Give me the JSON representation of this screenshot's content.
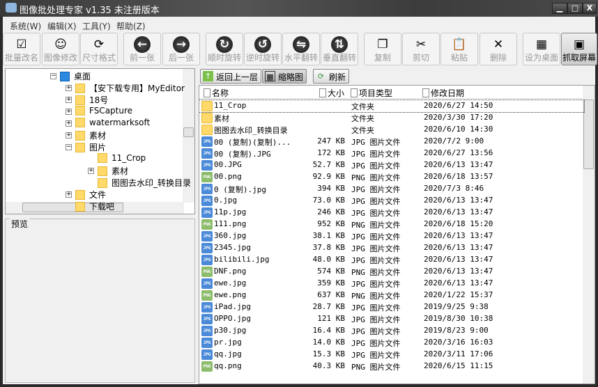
{
  "window": {
    "title": "图像批处理专家 v1.35 未注册版本",
    "min": "▁",
    "max": "□",
    "close": "X"
  },
  "menu": [
    "系统(W)",
    "编辑(X)",
    "工具(Y)",
    "帮助(Z)"
  ],
  "toolbar": [
    {
      "label": "批量改名",
      "icon": "rename-icon"
    },
    {
      "label": "图像修改",
      "icon": "portrait-icon"
    },
    {
      "label": "尺寸格式",
      "icon": "resize-icon"
    },
    {
      "label": "前一张",
      "icon": "arrow-left-icon"
    },
    {
      "label": "后一张",
      "icon": "arrow-right-icon"
    },
    {
      "label": "顺时旋转",
      "icon": "rotate-cw-icon"
    },
    {
      "label": "逆时旋转",
      "icon": "rotate-ccw-icon"
    },
    {
      "label": "水平翻转",
      "icon": "flip-horizontal-icon"
    },
    {
      "label": "垂直翻转",
      "icon": "flip-vertical-icon"
    },
    {
      "label": "复制",
      "icon": "copy-icon"
    },
    {
      "label": "剪切",
      "icon": "scissors-icon"
    },
    {
      "label": "粘贴",
      "icon": "paste-icon"
    },
    {
      "label": "删除",
      "icon": "delete-icon"
    },
    {
      "label": "设为桌面",
      "icon": "wallpaper-icon"
    },
    {
      "label": "抓取屏幕",
      "icon": "screenshot-icon"
    }
  ],
  "tree": [
    {
      "label": "桌面",
      "level": 0,
      "expander": "−"
    },
    {
      "label": "【安下载专用】MyEditor",
      "level": 1,
      "expander": "+"
    },
    {
      "label": "18号",
      "level": 1,
      "expander": "+"
    },
    {
      "label": "FSCapture",
      "level": 1,
      "expander": "+"
    },
    {
      "label": "watermarksoft",
      "level": 1,
      "expander": "+"
    },
    {
      "label": "素材",
      "level": 1,
      "expander": "+"
    },
    {
      "label": "图片",
      "level": 1,
      "expander": "−"
    },
    {
      "label": "11_Crop",
      "level": 2,
      "expander": ""
    },
    {
      "label": "素材",
      "level": 2,
      "expander": "+"
    },
    {
      "label": "图图去水印_转换目录",
      "level": 2,
      "expander": ""
    },
    {
      "label": "文件",
      "level": 1,
      "expander": "+"
    },
    {
      "label": "下载吧",
      "level": 1,
      "expander": ""
    }
  ],
  "preview_label": "预览",
  "nav": {
    "up": "返回上一层",
    "thumbs": "缩略图",
    "refresh": "刷新"
  },
  "columns": {
    "name": "名称",
    "size": "大小",
    "type": "项目类型",
    "date": "修改日期"
  },
  "files": [
    {
      "name": "11_Crop",
      "size": "",
      "type": "文件夹",
      "date": "2020/6/27 14:50",
      "kind": "folder"
    },
    {
      "name": "素材",
      "size": "",
      "type": "文件夹",
      "date": "2020/3/30 17:20",
      "kind": "folder"
    },
    {
      "name": "图图去水印_转换目录",
      "size": "",
      "type": "文件夹",
      "date": "2020/6/10 14:30",
      "kind": "folder"
    },
    {
      "name": "00 (复制)(复制)...",
      "size": "247 KB",
      "type": "JPG 图片文件",
      "date": "2020/7/2 9:00",
      "kind": "jpg"
    },
    {
      "name": "00 (复制).JPG",
      "size": "172 KB",
      "type": "JPG 图片文件",
      "date": "2020/6/27 13:56",
      "kind": "jpg"
    },
    {
      "name": "00.JPG",
      "size": "52.7 KB",
      "type": "JPG 图片文件",
      "date": "2020/6/13 13:47",
      "kind": "jpg"
    },
    {
      "name": "00.png",
      "size": "92.9 KB",
      "type": "PNG 图片文件",
      "date": "2020/6/18 13:57",
      "kind": "png"
    },
    {
      "name": "0 (复制).jpg",
      "size": "394 KB",
      "type": "JPG 图片文件",
      "date": "2020/7/3 8:46",
      "kind": "jpg"
    },
    {
      "name": "0.jpg",
      "size": "73.0 KB",
      "type": "JPG 图片文件",
      "date": "2020/6/13 13:47",
      "kind": "jpg"
    },
    {
      "name": "11p.jpg",
      "size": "246 KB",
      "type": "JPG 图片文件",
      "date": "2020/6/13 13:47",
      "kind": "jpg"
    },
    {
      "name": "111.png",
      "size": "952 KB",
      "type": "PNG 图片文件",
      "date": "2020/6/18 15:20",
      "kind": "png"
    },
    {
      "name": "360.jpg",
      "size": "38.1 KB",
      "type": "JPG 图片文件",
      "date": "2020/6/13 13:47",
      "kind": "jpg"
    },
    {
      "name": "2345.jpg",
      "size": "37.8 KB",
      "type": "JPG 图片文件",
      "date": "2020/6/13 13:47",
      "kind": "jpg"
    },
    {
      "name": "bilibili.jpg",
      "size": "48.0 KB",
      "type": "JPG 图片文件",
      "date": "2020/6/13 13:47",
      "kind": "jpg"
    },
    {
      "name": "DNF.png",
      "size": "574 KB",
      "type": "PNG 图片文件",
      "date": "2020/6/13 13:47",
      "kind": "png"
    },
    {
      "name": "ewe.jpg",
      "size": "359 KB",
      "type": "JPG 图片文件",
      "date": "2020/6/13 13:47",
      "kind": "jpg"
    },
    {
      "name": "ewe.png",
      "size": "637 KB",
      "type": "PNG 图片文件",
      "date": "2020/1/22 15:37",
      "kind": "png"
    },
    {
      "name": "iPad.jpg",
      "size": "28.7 KB",
      "type": "JPG 图片文件",
      "date": "2019/9/25 9:38",
      "kind": "jpg"
    },
    {
      "name": "OPPO.jpg",
      "size": "121 KB",
      "type": "JPG 图片文件",
      "date": "2019/8/30 10:38",
      "kind": "jpg"
    },
    {
      "name": "p30.jpg",
      "size": "16.4 KB",
      "type": "JPG 图片文件",
      "date": "2019/8/23 9:00",
      "kind": "jpg"
    },
    {
      "name": "pr.jpg",
      "size": "14.0 KB",
      "type": "JPG 图片文件",
      "date": "2020/3/16 16:03",
      "kind": "jpg"
    },
    {
      "name": "qq.jpg",
      "size": "15.3 KB",
      "type": "JPG 图片文件",
      "date": "2020/3/11 17:06",
      "kind": "jpg"
    },
    {
      "name": "qq.png",
      "size": "40.3 KB",
      "type": "PNG 图片文件",
      "date": "2020/6/15 11:15",
      "kind": "png"
    }
  ],
  "icon_glyphs": {
    "rename-icon": "☑",
    "portrait-icon": "☺",
    "resize-icon": "⟳",
    "arrow-left-icon": "←",
    "arrow-right-icon": "→",
    "rotate-cw-icon": "↻",
    "rotate-ccw-icon": "↺",
    "flip-horizontal-icon": "⇋",
    "flip-vertical-icon": "⇅",
    "copy-icon": "❐",
    "scissors-icon": "✂",
    "paste-icon": "📋",
    "delete-icon": "✕",
    "wallpaper-icon": "▦",
    "screenshot-icon": "▣"
  }
}
